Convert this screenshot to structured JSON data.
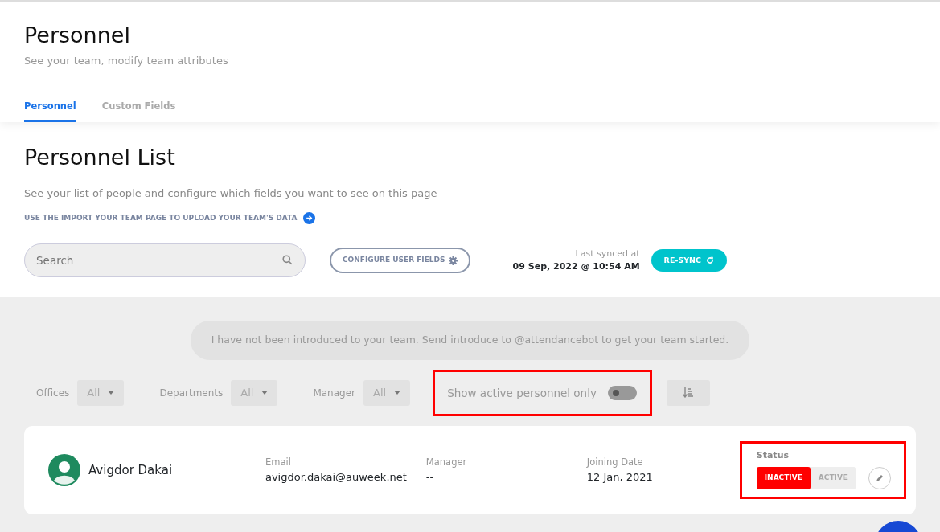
{
  "header": {
    "title": "Personnel",
    "subtitle": "See your team, modify team attributes"
  },
  "tabs": [
    {
      "label": "Personnel",
      "selected": true
    },
    {
      "label": "Custom Fields",
      "selected": false
    }
  ],
  "list": {
    "title": "Personnel List",
    "description": "See your list of people and configure which fields you want to see on this page",
    "import_link": "USE THE IMPORT YOUR TEAM PAGE TO UPLOAD YOUR TEAM'S DATA"
  },
  "search": {
    "placeholder": "Search"
  },
  "configure_button": "CONFIGURE USER FIELDS",
  "sync": {
    "label": "Last synced at",
    "time": "09 Sep, 2022 @ 10:54 AM",
    "button": "RE-SYNC"
  },
  "notice": "I have not been introduced to your team. Send introduce to @attendancebot to get your team started.",
  "filters": [
    {
      "label": "Offices",
      "value": "All"
    },
    {
      "label": "Departments",
      "value": "All"
    },
    {
      "label": "Manager",
      "value": "All"
    }
  ],
  "active_toggle": {
    "label": "Show active personnel only",
    "on": false,
    "highlighted": true
  },
  "people": [
    {
      "name": "Avigdor Dakai",
      "fields": [
        {
          "label": "Email",
          "value": "avigdor.dakai@auweek.net"
        },
        {
          "label": "Manager",
          "value": "--"
        },
        {
          "label": "Joining Date",
          "value": "12 Jan, 2021"
        }
      ],
      "status_label": "Status",
      "status_options": [
        {
          "label": "INACTIVE",
          "selected": true
        },
        {
          "label": "ACTIVE",
          "selected": false
        }
      ],
      "status_highlighted": true
    }
  ]
}
